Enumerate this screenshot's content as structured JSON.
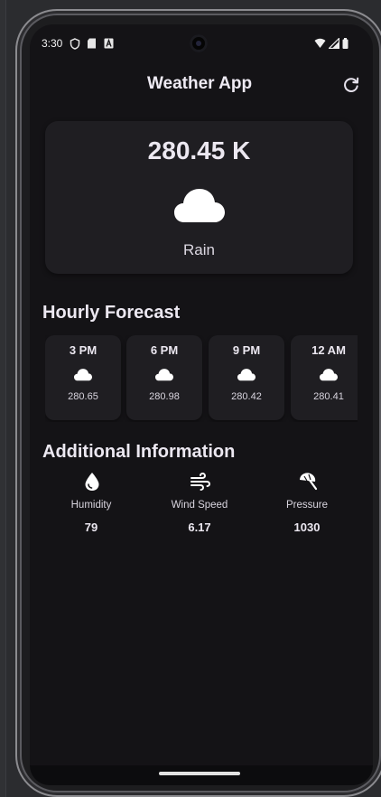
{
  "status_bar": {
    "time": "3:30"
  },
  "header": {
    "title": "Weather App"
  },
  "current": {
    "temperature": "280.45 K",
    "condition": "Rain",
    "icon": "cloud-icon"
  },
  "hourly": {
    "title": "Hourly Forecast",
    "items": [
      {
        "time": "3 PM",
        "temp": "280.65",
        "icon": "cloud-icon"
      },
      {
        "time": "6 PM",
        "temp": "280.98",
        "icon": "cloud-icon"
      },
      {
        "time": "9 PM",
        "temp": "280.42",
        "icon": "cloud-icon"
      },
      {
        "time": "12 AM",
        "temp": "280.41",
        "icon": "cloud-icon"
      }
    ]
  },
  "additional": {
    "title": "Additional Information",
    "items": [
      {
        "label": "Humidity",
        "value": "79",
        "icon": "water-drop-icon"
      },
      {
        "label": "Wind Speed",
        "value": "6.17",
        "icon": "wind-icon"
      },
      {
        "label": "Pressure",
        "value": "1030",
        "icon": "beach-umbrella-icon"
      }
    ]
  },
  "colors": {
    "background": "#141316",
    "card": "#1f1e22",
    "text": "#ece8f1"
  }
}
